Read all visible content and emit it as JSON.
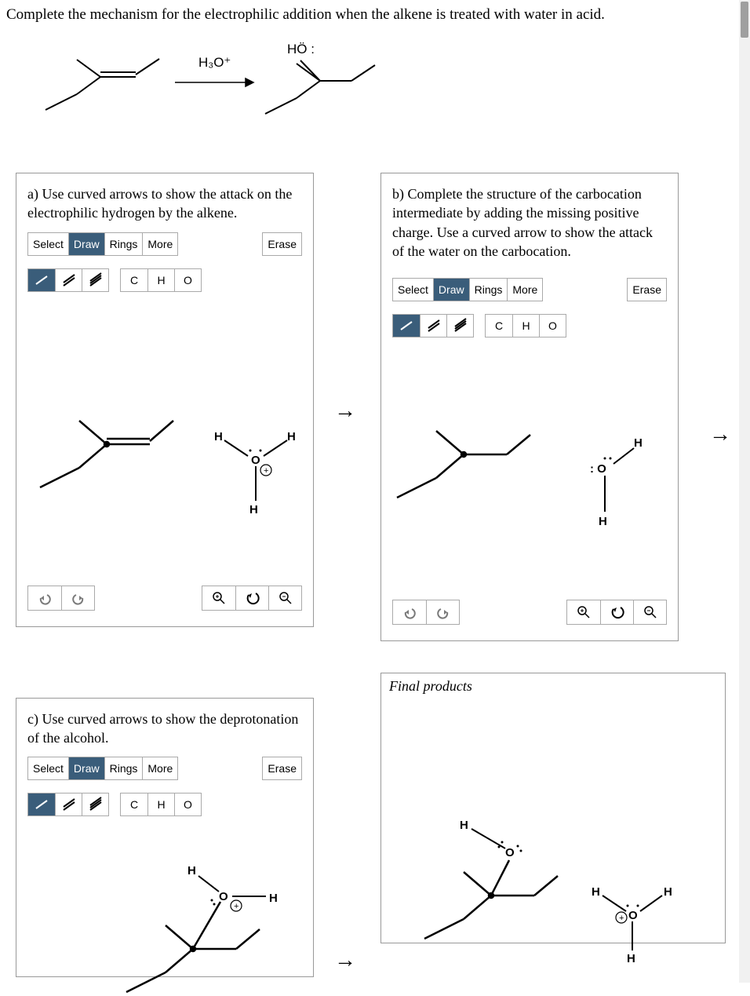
{
  "question": "Complete the mechanism for the electrophilic addition when the alkene is treated with water in acid.",
  "reagent": "H₃O⁺",
  "product_label": "HO :",
  "parts": {
    "a": {
      "prompt": "a) Use curved arrows to show the attack on the electrophilic hydrogen by the alkene."
    },
    "b": {
      "prompt": "b) Complete the structure of the carbocation intermediate by adding the missing positive charge. Use a curved arrow to show the attack of the water on the carbocation."
    },
    "c": {
      "prompt": "c) Use curved arrows to show the deprotonation of the alcohol."
    },
    "final": {
      "prompt": "Final products"
    }
  },
  "toolbar": {
    "select": "Select",
    "draw": "Draw",
    "rings": "Rings",
    "more": "More",
    "erase": "Erase",
    "atoms": {
      "c": "C",
      "h": "H",
      "o": "O"
    }
  },
  "atom_labels": {
    "H": "H",
    "O": "O",
    "colon_O": ": O",
    "O_colon": "O :",
    "plus": "+"
  },
  "arrow": "→"
}
